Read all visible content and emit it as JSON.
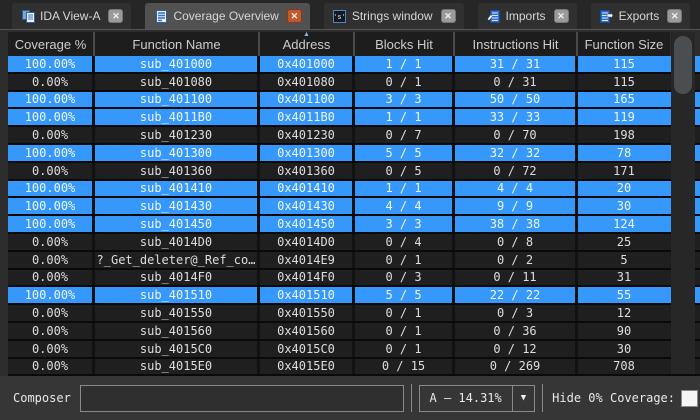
{
  "tabs": [
    {
      "label": "IDA View-A"
    },
    {
      "label": "Coverage Overview"
    },
    {
      "label": "Strings window"
    },
    {
      "label": "Imports"
    },
    {
      "label": "Exports"
    }
  ],
  "table": {
    "columns": [
      "Coverage %",
      "Function Name",
      "Address",
      "Blocks Hit",
      "Instructions Hit",
      "Function Size"
    ],
    "sorted_column": "Address",
    "sort_direction": "ascending",
    "sort_indicator": "▲",
    "rows": [
      {
        "coverage": "100.00%",
        "name": "sub_401000",
        "address": "0x401000",
        "blocks": "1 / 1",
        "instructions": "31 / 31",
        "size": "115",
        "covered": true
      },
      {
        "coverage": "0.00%",
        "name": "sub_401080",
        "address": "0x401080",
        "blocks": "0 / 1",
        "instructions": "0 / 31",
        "size": "115",
        "covered": false
      },
      {
        "coverage": "100.00%",
        "name": "sub_401100",
        "address": "0x401100",
        "blocks": "3 / 3",
        "instructions": "50 / 50",
        "size": "165",
        "covered": true
      },
      {
        "coverage": "100.00%",
        "name": "sub_4011B0",
        "address": "0x4011B0",
        "blocks": "1 / 1",
        "instructions": "33 / 33",
        "size": "119",
        "covered": true
      },
      {
        "coverage": "0.00%",
        "name": "sub_401230",
        "address": "0x401230",
        "blocks": "0 / 7",
        "instructions": "0 / 70",
        "size": "198",
        "covered": false
      },
      {
        "coverage": "100.00%",
        "name": "sub_401300",
        "address": "0x401300",
        "blocks": "5 / 5",
        "instructions": "32 / 32",
        "size": "78",
        "covered": true
      },
      {
        "coverage": "0.00%",
        "name": "sub_401360",
        "address": "0x401360",
        "blocks": "0 / 5",
        "instructions": "0 / 72",
        "size": "171",
        "covered": false
      },
      {
        "coverage": "100.00%",
        "name": "sub_401410",
        "address": "0x401410",
        "blocks": "1 / 1",
        "instructions": "4 / 4",
        "size": "20",
        "covered": true
      },
      {
        "coverage": "100.00%",
        "name": "sub_401430",
        "address": "0x401430",
        "blocks": "4 / 4",
        "instructions": "9 / 9",
        "size": "30",
        "covered": true
      },
      {
        "coverage": "100.00%",
        "name": "sub_401450",
        "address": "0x401450",
        "blocks": "3 / 3",
        "instructions": "38 / 38",
        "size": "124",
        "covered": true
      },
      {
        "coverage": "0.00%",
        "name": "sub_4014D0",
        "address": "0x4014D0",
        "blocks": "0 / 4",
        "instructions": "0 / 8",
        "size": "25",
        "covered": false
      },
      {
        "coverage": "0.00%",
        "name": "?_Get_deleter@_Ref_co…",
        "address": "0x4014E9",
        "blocks": "0 / 1",
        "instructions": "0 / 2",
        "size": "5",
        "covered": false
      },
      {
        "coverage": "0.00%",
        "name": "sub_4014F0",
        "address": "0x4014F0",
        "blocks": "0 / 3",
        "instructions": "0 / 11",
        "size": "31",
        "covered": false
      },
      {
        "coverage": "100.00%",
        "name": "sub_401510",
        "address": "0x401510",
        "blocks": "5 / 5",
        "instructions": "22 / 22",
        "size": "55",
        "covered": true
      },
      {
        "coverage": "0.00%",
        "name": "sub_401550",
        "address": "0x401550",
        "blocks": "0 / 1",
        "instructions": "0 / 3",
        "size": "12",
        "covered": false
      },
      {
        "coverage": "0.00%",
        "name": "sub_401560",
        "address": "0x401560",
        "blocks": "0 / 1",
        "instructions": "0 / 36",
        "size": "90",
        "covered": false
      },
      {
        "coverage": "0.00%",
        "name": "sub_4015C0",
        "address": "0x4015C0",
        "blocks": "0 / 1",
        "instructions": "0 / 12",
        "size": "30",
        "covered": false
      },
      {
        "coverage": "0.00%",
        "name": "sub_4015E0",
        "address": "0x4015E0",
        "blocks": "0 / 15",
        "instructions": "0 / 269",
        "size": "708",
        "covered": false
      }
    ]
  },
  "footer": {
    "composer_label": "Composer",
    "composer_value": "",
    "coverage_selector": "A – 14.31%",
    "dropdown_arrow": "▼",
    "hide_zero_label": "Hide 0% Coverage:",
    "hide_zero_checked": false
  },
  "colors": {
    "covered_row": "#3698fb",
    "uncovered_row": "#1f1f1f",
    "active_tab_close": "#bf5b2d",
    "header_bg": "#1d1d1d"
  }
}
